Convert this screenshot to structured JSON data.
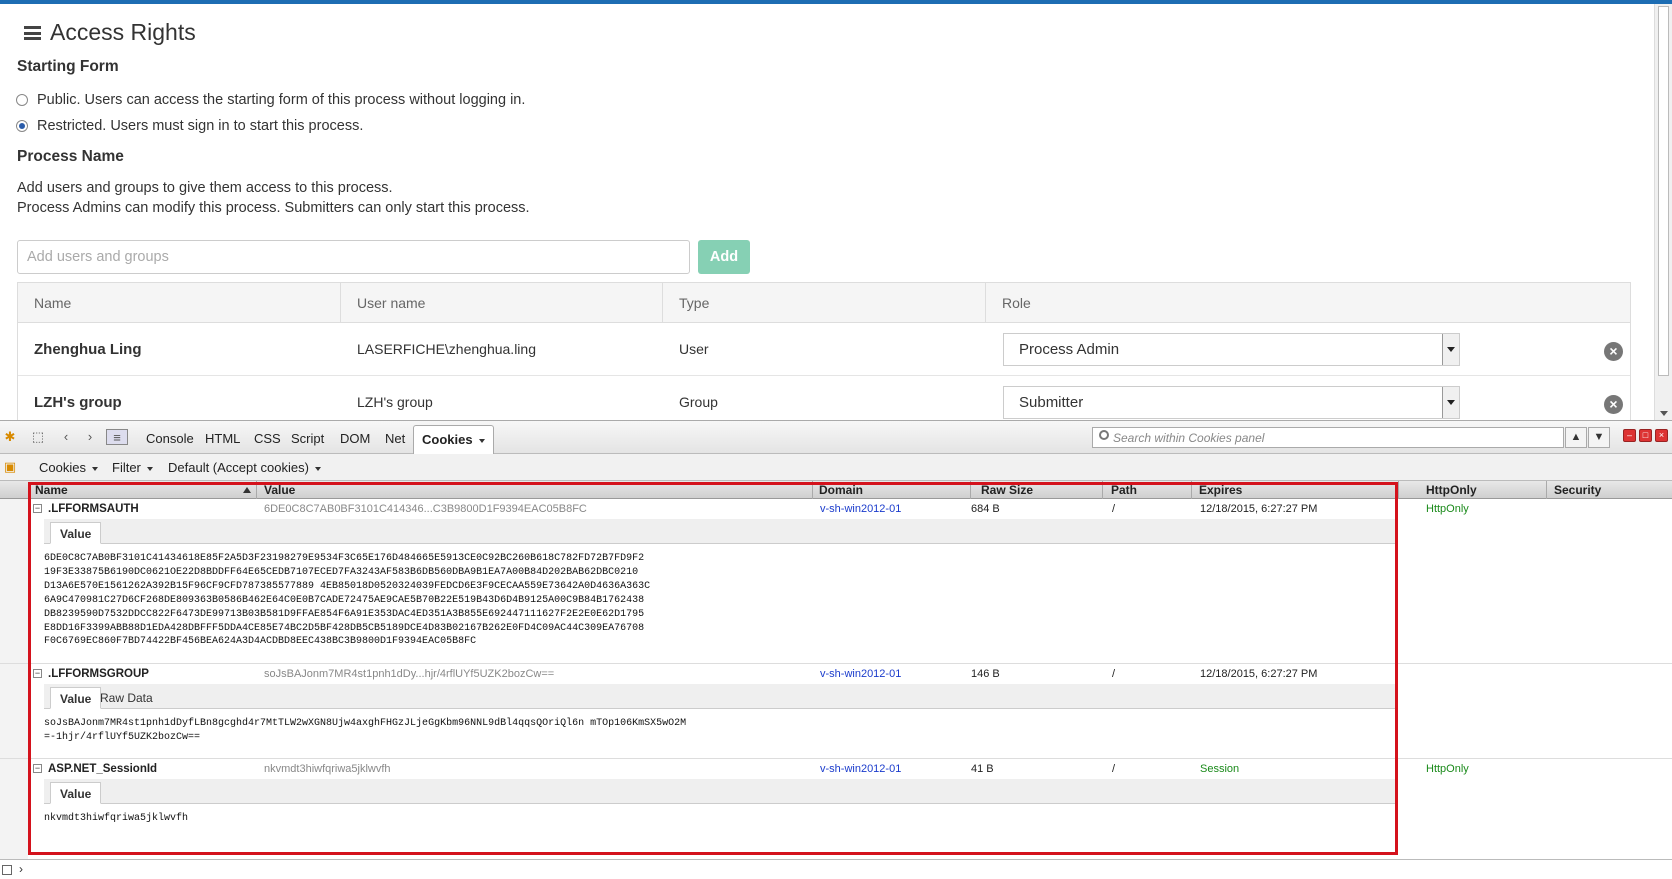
{
  "app": {
    "title": "Access Rights",
    "starting_form_heading": "Starting Form",
    "radio_public": "Public. Users can access the starting form of this process without logging in.",
    "radio_restricted": "Restricted. Users must sign in to start this process.",
    "selected_radio": "restricted",
    "process_name_heading": "Process Name",
    "desc_line1": "Add users and groups to give them access to this process.",
    "desc_line2": "Process Admins can modify this process. Submitters can only start this process.",
    "add_placeholder": "Add users and groups",
    "add_button": "Add",
    "table": {
      "headers": [
        "Name",
        "User name",
        "Type",
        "Role"
      ],
      "rows": [
        {
          "name": "Zhenghua Ling",
          "username": "LASERFICHE\\zhenghua.ling",
          "type": "User",
          "role": "Process Admin"
        },
        {
          "name": "LZH's group",
          "username": "LZH's group",
          "type": "Group",
          "role": "Submitter"
        }
      ]
    }
  },
  "firebug": {
    "tabs": [
      "Console",
      "HTML",
      "CSS",
      "Script",
      "DOM",
      "Net",
      "Cookies"
    ],
    "active_tab": "Cookies",
    "search_placeholder": "Search within Cookies panel",
    "sub_toolbar": [
      "Cookies",
      "Filter",
      "Default (Accept cookies)"
    ],
    "columns": [
      "Name",
      "Value",
      "Domain",
      "Raw Size",
      "Path",
      "Expires",
      "HttpOnly",
      "Security"
    ],
    "cookies": [
      {
        "name": ".LFFORMSAUTH",
        "value": "6DE0C8C7AB0BF3101C414346...C3B9800D1F9394EAC05B8FC",
        "domain": "v-sh-win2012-01",
        "size": "684 B",
        "path": "/",
        "expires": "12/18/2015, 6:27:27 PM",
        "httponly": "HttpOnly",
        "tabs": [
          "Value"
        ],
        "detail_lines": [
          "6DE0C8C7AB0BF3101C41434618E85F2A5D3F23198279E9534F3C65E176D484665E5913CE0C92BC260B618C782FD72B7FD9F2",
          "19F3E33875B6190DC0621OE22D8BDDFF64E65CEDB7107ECED7FA3243AF583B6DB560DBA9B1EA7A00B84D202BAB62DBC0210",
          "D13A6E570E1561262A392B15F96CF9CFD787385577889 4EB85018D0520324039FEDCD6E3F9CECAA559E73642A0D4636A363C",
          "6A9C470981C27D6CF268DE809363B0586B462E64C0E0B7CADE72475AE9CAE5B70B22E519B43D6D4B9125A00C9B84B1762438",
          "DB8239590D7532DDCC822F6473DE99713B03B581D9FFAE854F6A91E353DAC4ED351A3B855E692447111627F2E2E0E62D1795",
          "E8DD16F3399ABB88D1EDA428DBFFF5DDA4CE85E74BC2D5BF428DB5CB5189DCE4D83B02167B262E0FD4C09AC44C309EA76708",
          "F0C6769EC860F7BD74422BF456BEA624A3D4ACDBD8EEC438BC3B9800D1F9394EAC05B8FC"
        ]
      },
      {
        "name": ".LFFORMSGROUP",
        "value": "soJsBAJonm7MR4st1pnh1dDy...hjr/4rflUYf5UZK2bozCw==",
        "domain": "v-sh-win2012-01",
        "size": "146 B",
        "path": "/",
        "expires": "12/18/2015, 6:27:27 PM",
        "httponly": "",
        "tabs": [
          "Value",
          "Raw Data"
        ],
        "detail_lines": [
          "soJsBAJonm7MR4st1pnh1dDyfLBn8gcghd4r7MtTLW2wXGN8Ujw4axghFHGzJLjeGgKbm96NNL9dBl4qqsQOriQl6n mTOp106KmSX5wO2M",
          "=-1hjr/4rflUYf5UZK2bozCw=="
        ]
      },
      {
        "name": "ASP.NET_SessionId",
        "value": "nkvmdt3hiwfqriwa5jklwvfh",
        "domain": "v-sh-win2012-01",
        "size": "41 B",
        "path": "/",
        "expires": "Session",
        "httponly": "HttpOnly",
        "tabs": [
          "Value"
        ],
        "detail_lines": [
          "nkvmdt3hiwfqriwa5jklwvfh"
        ]
      }
    ],
    "colors": {
      "accent_bar": "#1d6db3",
      "highlight_box": "#d4121c",
      "domain_link": "#1a3bcc",
      "httponly": "#1a8a1a"
    }
  }
}
